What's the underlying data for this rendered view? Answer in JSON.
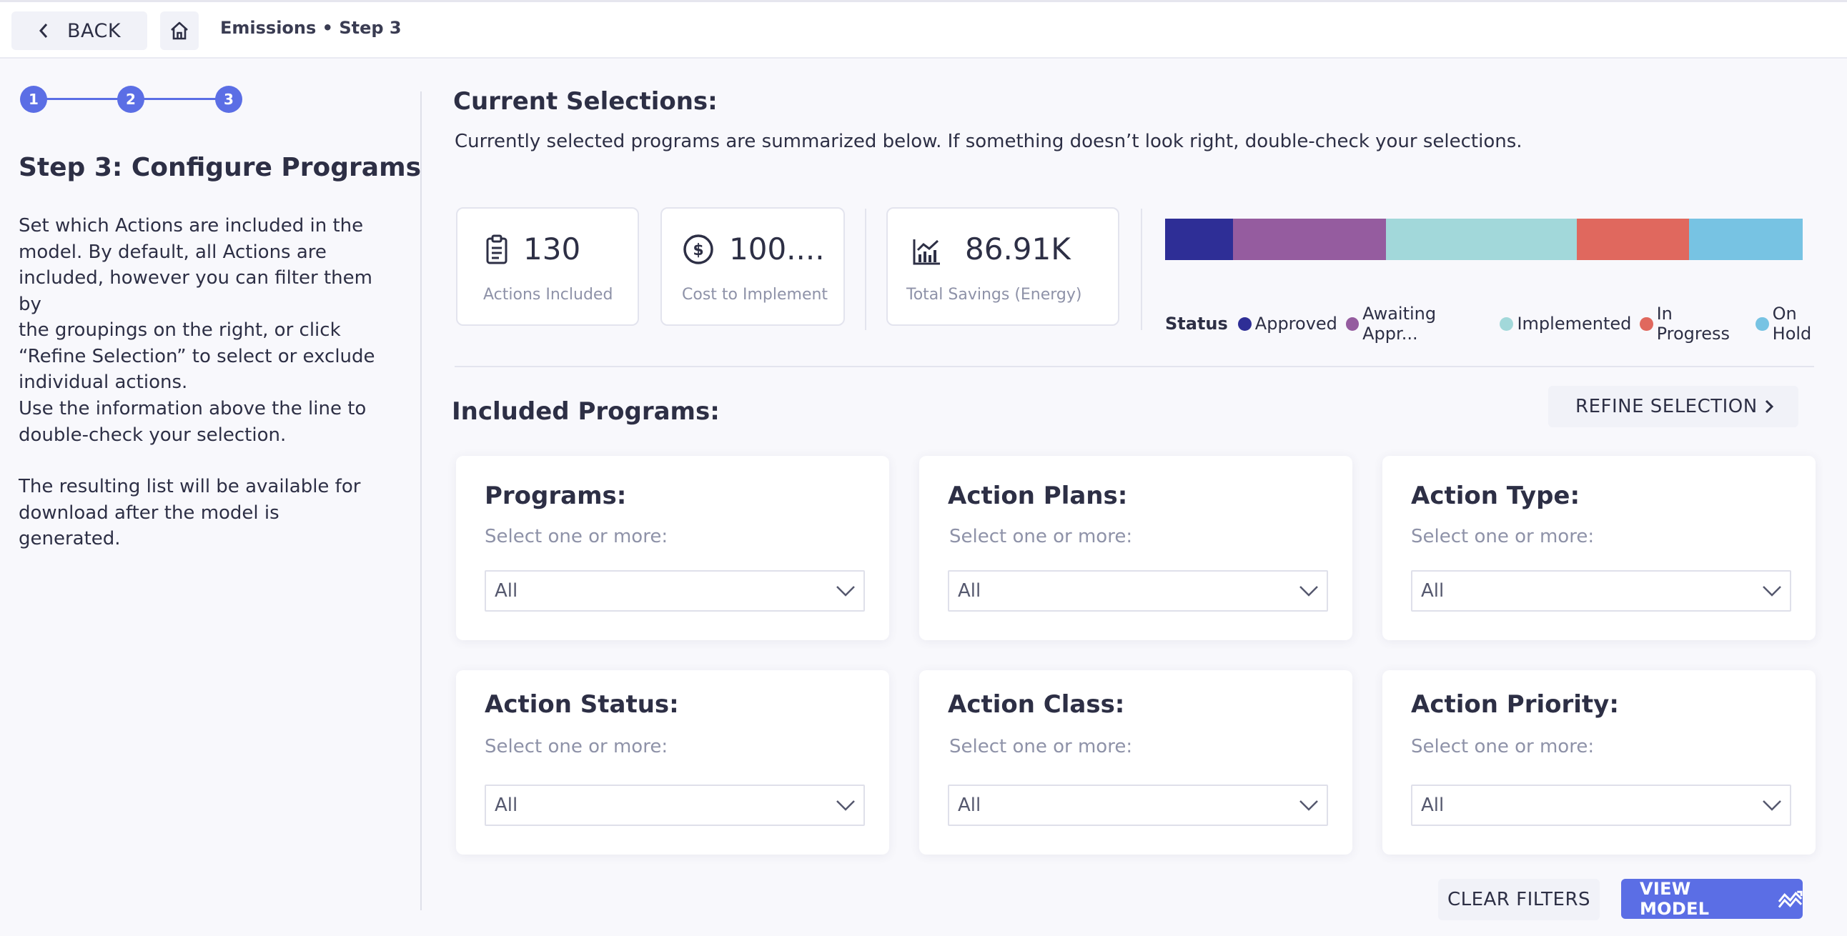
{
  "header": {
    "back_label": "BACK",
    "breadcrumb": "Emissions • Step 3"
  },
  "stepper": {
    "steps": [
      "1",
      "2",
      "3"
    ],
    "current": 3
  },
  "left": {
    "title": "Step 3: Configure Programs",
    "paragraphs": [
      [
        "Set which Actions are included in the",
        "model. By default, all Actions are",
        "included, however you can filter them by",
        "the groupings on the right, or click",
        "“Refine Selection” to select or exclude",
        "individual actions."
      ],
      [
        "Use the information above the line to",
        "double-check your selection."
      ],
      [
        "The resulting list will be available for",
        "download after the model is generated."
      ]
    ]
  },
  "current": {
    "heading": "Current Selections:",
    "description": "Currently selected programs are summarized below. If something doesn’t look right, double-check your selections."
  },
  "stats": [
    {
      "value": "130",
      "label": "Actions Included",
      "icon": "clipboard-icon"
    },
    {
      "value": "100....",
      "label": "Cost to Implement",
      "icon": "dollar-coin-icon"
    },
    {
      "value": "86.91K",
      "label": "Total Savings (Energy)",
      "icon": "chart-icon"
    }
  ],
  "status_chart": {
    "legend_title": "Status",
    "segments": [
      {
        "name": "Approved",
        "fraction": 0.107,
        "color": "#2e2e96"
      },
      {
        "name": "Awaiting Appr...",
        "fraction": 0.239,
        "color": "#955c9f"
      },
      {
        "name": "Implemented",
        "fraction": 0.3,
        "color": "#a2d8da"
      },
      {
        "name": "In Progress",
        "fraction": 0.176,
        "color": "#e0685e"
      },
      {
        "name": "On Hold",
        "fraction": 0.178,
        "color": "#77c3e3"
      }
    ]
  },
  "included": {
    "heading": "Included Programs:",
    "refine_label": "REFINE SELECTION"
  },
  "filters": [
    {
      "title": "Programs:",
      "hint": "Select one or more:",
      "value": "All"
    },
    {
      "title": "Action Plans:",
      "hint": "Select one or more:",
      "value": "All"
    },
    {
      "title": "Action Type:",
      "hint": "Select one or more:",
      "value": "All"
    },
    {
      "title": "Action Status:",
      "hint": "Select one or more:",
      "value": "All"
    },
    {
      "title": "Action Class:",
      "hint": "Select one or more:",
      "value": "All"
    },
    {
      "title": "Action Priority:",
      "hint": "Select one or more:",
      "value": "All"
    }
  ],
  "footer": {
    "clear_label": "CLEAR FILTERS",
    "view_label": "VIEW MODEL"
  }
}
